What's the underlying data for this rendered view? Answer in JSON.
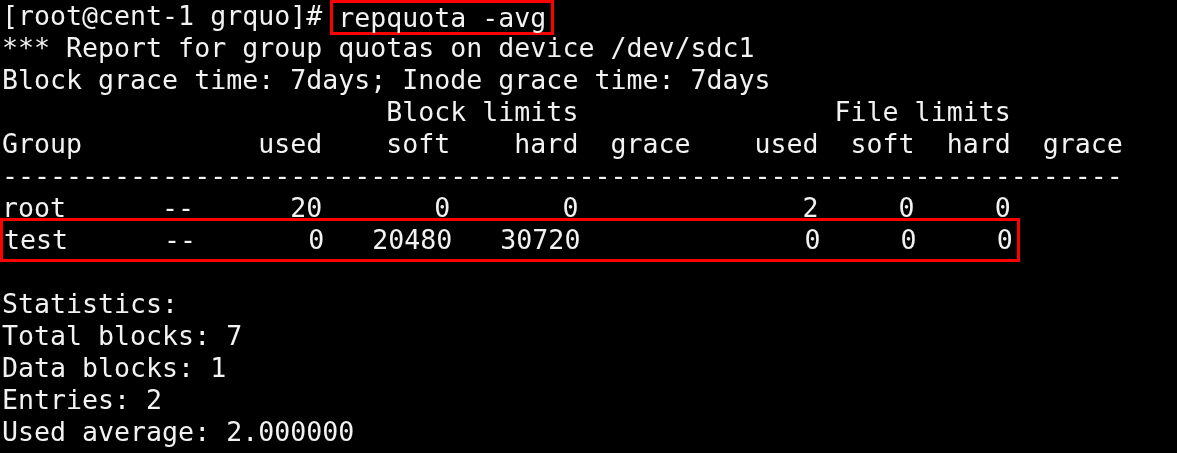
{
  "prompt": "[root@cent-1 grquo]#",
  "command": {
    "text": "repquota -avg",
    "highlighted": true
  },
  "lines": [
    {
      "kind": "text",
      "text": "*** Report for group quotas on device /dev/sdc1",
      "highlighted": false
    },
    {
      "kind": "text",
      "text": "Block grace time: 7days; Inode grace time: 7days",
      "highlighted": false
    },
    {
      "kind": "text",
      "text": "                        Block limits                File limits",
      "highlighted": false
    },
    {
      "kind": "text",
      "text": "Group           used    soft    hard  grace    used  soft  hard  grace",
      "highlighted": false
    },
    {
      "kind": "text",
      "text": "----------------------------------------------------------------------",
      "highlighted": false
    },
    {
      "kind": "text",
      "text": "root      --      20       0       0              2     0     0",
      "highlighted": false
    },
    {
      "kind": "text",
      "text": "test      --       0   20480   30720              0     0     0",
      "highlighted": true
    },
    {
      "kind": "blank"
    },
    {
      "kind": "text",
      "text": "Statistics:",
      "highlighted": false
    },
    {
      "kind": "text",
      "text": "Total blocks: 7",
      "highlighted": false
    },
    {
      "kind": "text",
      "text": "Data blocks: 1",
      "highlighted": false
    },
    {
      "kind": "text",
      "text": "Entries: 2",
      "highlighted": false
    },
    {
      "kind": "text",
      "text": "Used average: 2.000000",
      "highlighted": false
    }
  ]
}
